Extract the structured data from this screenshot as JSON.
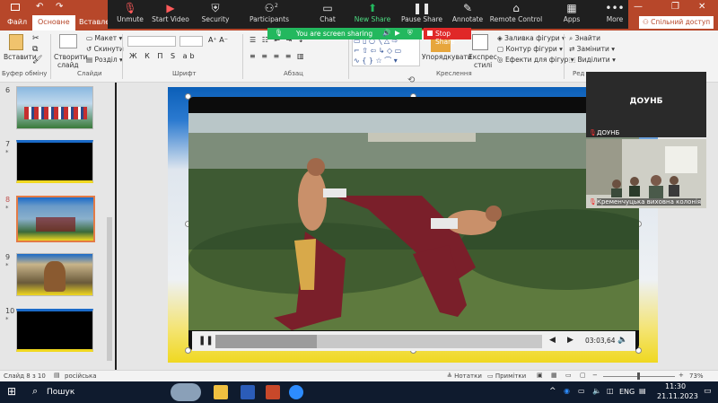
{
  "ribbon_tabs": [
    {
      "label": "Файл"
    },
    {
      "label": "Основне"
    },
    {
      "label": "Вставлен"
    }
  ],
  "title_right": {
    "share": "Спільний доступ"
  },
  "zoom_toolbar": [
    {
      "label": "Unmute",
      "icon": "microphone-muted-icon"
    },
    {
      "label": "Start Video",
      "icon": "video-off-icon"
    },
    {
      "label": "Security",
      "icon": "shield-icon"
    },
    {
      "label": "Participants",
      "icon": "participants-icon",
      "count": "2"
    },
    {
      "label": "Chat",
      "icon": "chat-icon"
    },
    {
      "label": "New Share",
      "icon": "share-icon"
    },
    {
      "label": "Pause Share",
      "icon": "pause-icon"
    },
    {
      "label": "Annotate",
      "icon": "pen-icon"
    },
    {
      "label": "Remote Control",
      "icon": "remote-control-icon"
    },
    {
      "label": "Apps",
      "icon": "apps-icon"
    },
    {
      "label": "More",
      "icon": "more-icon"
    }
  ],
  "share_bar": {
    "text": "You are screen sharing",
    "stop": "Stop Share"
  },
  "ribbon": {
    "paste": "Вставити",
    "new_slide_1": "Створити",
    "new_slide_2": "слайд",
    "layout": "Макет",
    "reset": "Скинути",
    "section": "Розділ",
    "arrange": "Упорядкувати",
    "express_1": "Експрес-",
    "express_2": "стилі",
    "fill": "Заливка фігури",
    "outline": "Контур фігури",
    "effects": "Ефекти для фігур",
    "find": "Знайти",
    "replace": "Замінити",
    "select": "Виділити",
    "groups": {
      "clipboard": "Буфер обміну",
      "slides": "Слайди",
      "font": "Шрифт",
      "paragraph": "Абзац",
      "drawing": "Креслення",
      "editing": "Ред"
    }
  },
  "slides": [
    {
      "num": "6"
    },
    {
      "num": "7",
      "star": "*"
    },
    {
      "num": "8",
      "star": "*"
    },
    {
      "num": "9",
      "star": "*"
    },
    {
      "num": "10",
      "star": "*"
    }
  ],
  "video": {
    "time": "03:03,64",
    "progress": 0.31
  },
  "participants": [
    {
      "name": "ДОУНБ",
      "tile_name": "ДОУНБ"
    },
    {
      "name": "Кременчуцька виховна колонія"
    }
  ],
  "status": {
    "slide": "Слайд 8 з 10",
    "lang": "російська",
    "notes": "Нотатки",
    "comments": "Примітки",
    "zoom": "73%"
  },
  "taskbar": {
    "search": "Пошук",
    "lang": "ENG",
    "time": "11:30",
    "date": "21.11.2023"
  },
  "colors": {
    "accent": "#b7472a",
    "share_green": "#23b85e",
    "stop_red": "#e02828"
  }
}
